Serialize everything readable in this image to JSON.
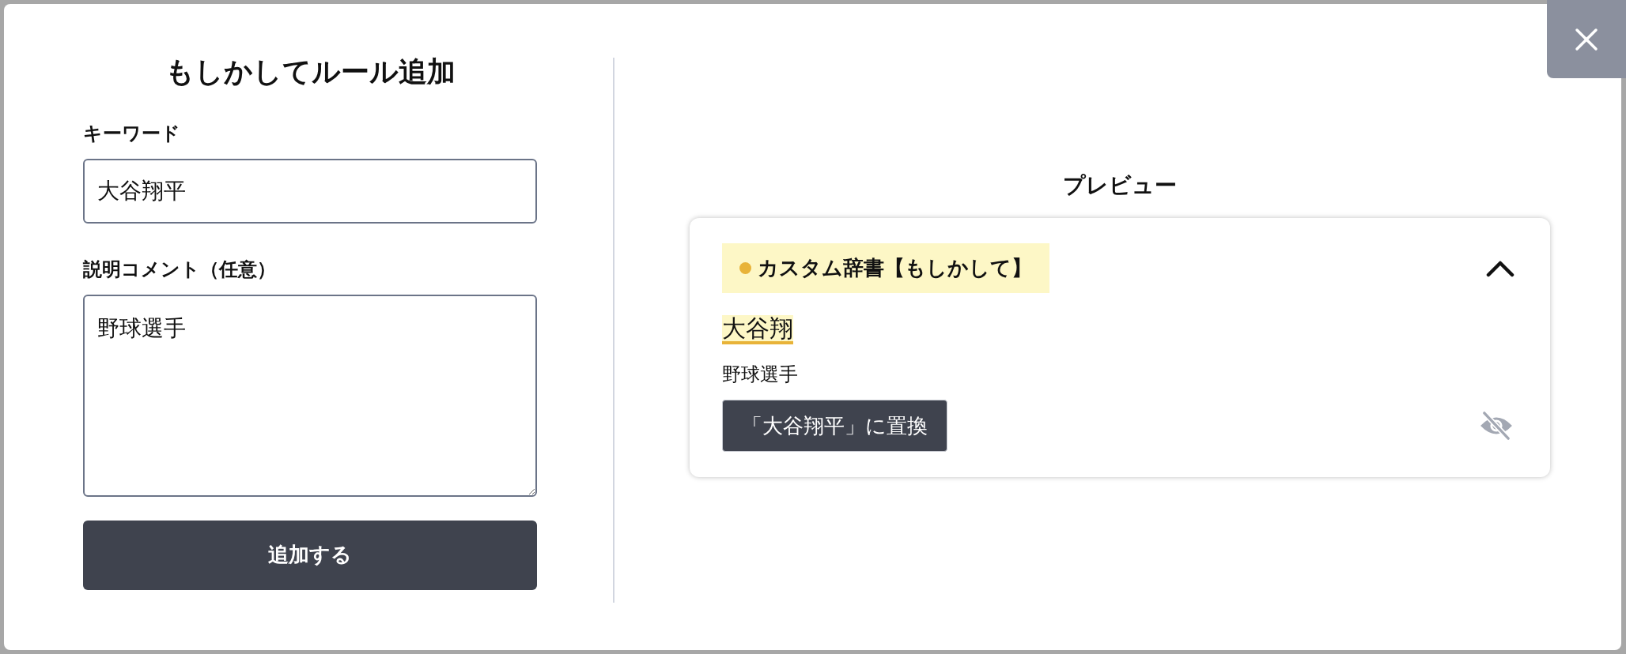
{
  "dialog": {
    "title": "もしかしてルール追加"
  },
  "form": {
    "keyword": {
      "label": "キーワード",
      "value": "大谷翔平"
    },
    "comment": {
      "label": "説明コメント（任意）",
      "value": "野球選手"
    },
    "submit_button": "追加する"
  },
  "preview": {
    "title": "プレビュー",
    "card": {
      "badge": {
        "label": "カスタム辞書【もしかして】",
        "color": "#e8b339"
      },
      "expanded": true,
      "match_text": "大谷翔",
      "comment": "野球選手",
      "replace_button": "「大谷翔平」に置換"
    }
  }
}
